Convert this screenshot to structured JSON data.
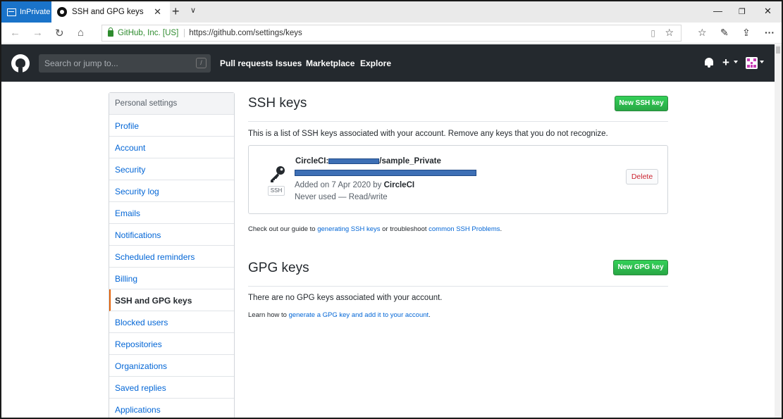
{
  "browser": {
    "inprivate_label": "InPrivate",
    "tab_title": "SSH and GPG keys",
    "new_tab_glyph": "+",
    "tab_menu_glyph": "∨",
    "cert_label": "GitHub, Inc. [US]",
    "url": "https://github.com/settings/keys",
    "controls": {
      "min": "—",
      "max": "❐",
      "close": "✕"
    }
  },
  "header": {
    "search_placeholder": "Search or jump to...",
    "search_shortcut": "/",
    "nav": [
      "Pull requests",
      "Issues",
      "Marketplace",
      "Explore"
    ]
  },
  "sidebar": {
    "heading": "Personal settings",
    "items": [
      {
        "label": "Profile"
      },
      {
        "label": "Account"
      },
      {
        "label": "Security"
      },
      {
        "label": "Security log"
      },
      {
        "label": "Emails"
      },
      {
        "label": "Notifications"
      },
      {
        "label": "Scheduled reminders"
      },
      {
        "label": "Billing"
      },
      {
        "label": "SSH and GPG keys"
      },
      {
        "label": "Blocked users"
      },
      {
        "label": "Repositories"
      },
      {
        "label": "Organizations"
      },
      {
        "label": "Saved replies"
      },
      {
        "label": "Applications"
      }
    ],
    "selected_index": 8
  },
  "ssh": {
    "title": "SSH keys",
    "new_button": "New SSH key",
    "description": "This is a list of SSH keys associated with your account. Remove any keys that you do not recognize.",
    "key": {
      "badge": "SSH",
      "title_prefix": "CircleCI:",
      "title_suffix": "/sample_Private",
      "added_prefix": "Added on 7 Apr 2020 by ",
      "added_by": "CircleCI",
      "usage": "Never used — Read/write",
      "delete_button": "Delete"
    },
    "note_prefix": "Check out our guide to ",
    "note_link1": "generating SSH keys",
    "note_middle": " or troubleshoot ",
    "note_link2": "common SSH Problems",
    "note_suffix": "."
  },
  "gpg": {
    "title": "GPG keys",
    "new_button": "New GPG key",
    "description": "There are no GPG keys associated with your account.",
    "note_prefix": "Learn how to ",
    "note_link": "generate a GPG key and add it to your account",
    "note_suffix": "."
  },
  "colors": {
    "header_bg": "#24292e",
    "link": "#0366d6",
    "primary_green": "#28a745",
    "danger": "#cb2431",
    "selected_marker": "#e36209",
    "inprivate_blue": "#1a73c9",
    "redaction": "#3d6fb5"
  }
}
